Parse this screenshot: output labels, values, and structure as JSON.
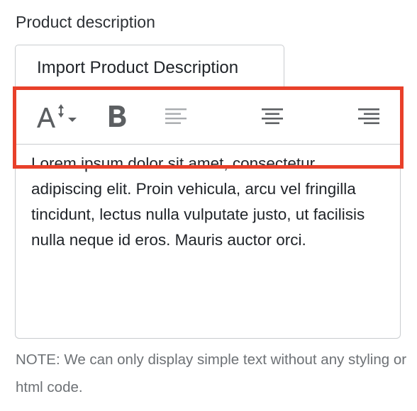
{
  "field": {
    "label": "Product description"
  },
  "tab": {
    "label": "Import Product Description"
  },
  "toolbar": {
    "buttons": [
      {
        "icon": "text-size-icon",
        "label": "Text size"
      },
      {
        "icon": "bold-icon",
        "label": "Bold"
      },
      {
        "icon": "align-left-icon",
        "label": "Align left"
      },
      {
        "icon": "align-center-icon",
        "label": "Align center"
      },
      {
        "icon": "align-right-icon",
        "label": "Align right"
      }
    ]
  },
  "editor": {
    "content": "Lorem ipsum dolor sit amet, consectetur adipiscing elit. Proin vehicula, arcu vel fringilla tincidunt, lectus nulla vulputate justo, ut facilisis nulla neque id eros. Mauris auctor orci."
  },
  "note": {
    "text": "NOTE: We can only display simple text without any styling or html code."
  },
  "colors": {
    "highlight": "#e8402a",
    "icon_active": "#5c5f62",
    "icon_disabled": "#a8abae",
    "note_text": "#6d7175",
    "border": "#c9cccf"
  }
}
